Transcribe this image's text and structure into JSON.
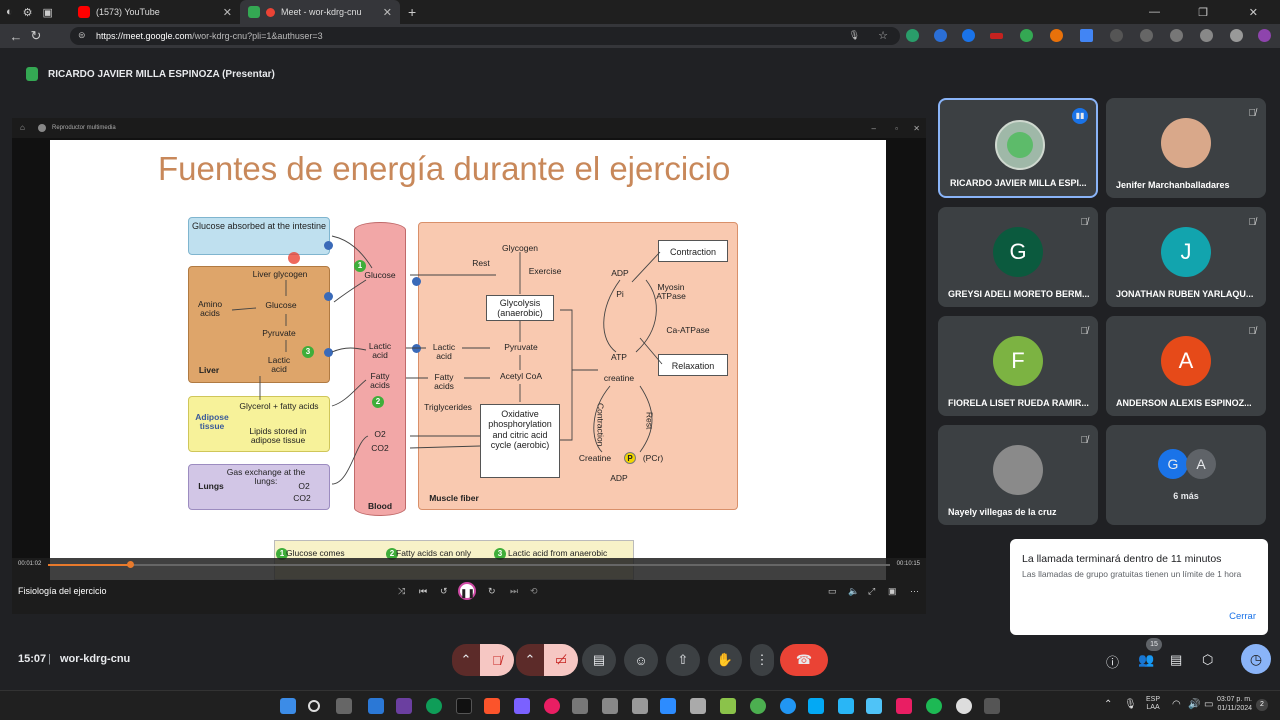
{
  "browser": {
    "tabs": [
      {
        "label": "(1573) YouTube",
        "active": false
      },
      {
        "label": "Meet - wor-kdrg-cnu",
        "active": true
      }
    ],
    "url_host": "https://meet.google.com",
    "url_path": "/wor-kdrg-cnu?pli=1&authuser=3"
  },
  "meet": {
    "presenter": "RICARDO JAVIER MILLA ESPINOZA (Presentar)",
    "time": "15:07",
    "meeting_code": "wor-kdrg-cnu",
    "participant_badge": "15"
  },
  "player": {
    "title": "Reproductor multimedia",
    "video_name": "Fisiología del ejercicio",
    "time_current": "00:01:02",
    "time_total": "00:10:15",
    "progress": 0.097
  },
  "slide": {
    "title": "Fuentes de energía durante el ejercicio",
    "labels": {
      "glucose_absorbed": "Glucose absorbed at the intestine",
      "liver_glycogen": "Liver glycogen",
      "amino_acids": "Amino acids",
      "glucose_liver": "Glucose",
      "pyruvate_liver": "Pyruvate",
      "lactic_liver": "Lactic acid",
      "liver": "Liver",
      "adipose": "Adipose tissue",
      "glycerol": "Glycerol + fatty acids",
      "lipids_stored": "Lipids stored in adipose tissue",
      "lungs": "Lungs",
      "gas_exchange": "Gas exchange at the lungs:",
      "o2_lungs": "O2",
      "co2_lungs": "CO2",
      "glucose_blood": "Glucose",
      "lactic_blood": "Lactic acid",
      "fatty_blood": "Fatty acids",
      "o2_blood": "O2",
      "co2_blood": "CO2",
      "blood": "Blood",
      "glycogen": "Glycogen",
      "rest": "Rest",
      "exercise": "Exercise",
      "glycolysis": "Glycolysis (anaerobic)",
      "lactic_muscle": "Lactic acid",
      "pyruvate_muscle": "Pyruvate",
      "fatty_muscle": "Fatty acids",
      "acetyl": "Acetyl CoA",
      "triglycerides": "Triglycerides",
      "oxphos": "Oxidative phosphorylation and citric acid cycle (aerobic)",
      "muscle_fiber": "Muscle fiber",
      "adp_top": "ADP",
      "pi": "Pi",
      "myosin": "Myosin ATPase",
      "ca_atpase": "Ca-ATPase",
      "contraction_box": "Contraction",
      "relaxation_box": "Relaxation",
      "atp": "ATP",
      "creatine": "creatine",
      "contraction_side": "Contraction",
      "rest_side": "Rest",
      "creatine_pcr": "Creatine",
      "pcr": "(PCr)",
      "adp_bottom": "ADP",
      "legend1": "Glucose comes",
      "legend2": "Fatty acids can only",
      "legend3": "Lactic acid from anaerobic"
    }
  },
  "participants": [
    {
      "name": "RICARDO JAVIER MILLA ESPI...",
      "initial": "",
      "color": "#9fb8a8",
      "speaking": true
    },
    {
      "name": "Jenifer Marchanballadares",
      "initial": "",
      "color": "#d9a88a",
      "speaking": false
    },
    {
      "name": "GREYSI ADELI MORETO BERM...",
      "initial": "G",
      "color": "#0b5a3e",
      "speaking": false
    },
    {
      "name": "JONATHAN RUBEN YARLAQU...",
      "initial": "J",
      "color": "#12a4ae",
      "speaking": false
    },
    {
      "name": "FIORELA LISET RUEDA RAMIR...",
      "initial": "F",
      "color": "#7cb342",
      "speaking": false
    },
    {
      "name": "ANDERSON ALEXIS ESPINOZ...",
      "initial": "A",
      "color": "#e64a19",
      "speaking": false
    },
    {
      "name": "Nayely villegas de la cruz",
      "initial": "",
      "color": "#8a8a8a",
      "speaking": false
    },
    {
      "name": "6 más",
      "initial": "",
      "color": "#3c4043",
      "speaking": false
    }
  ],
  "more_avatars": [
    "G",
    "A"
  ],
  "toast": {
    "title": "La llamada terminará dentro de 11 minutos",
    "body": "Las llamadas de grupo gratuitas tienen un límite de 1 hora",
    "action": "Cerrar"
  },
  "tray": {
    "lang": "ESP",
    "lang2": "LAA",
    "time": "03:07 p. m.",
    "date": "01/11/2024",
    "notif": "2"
  }
}
